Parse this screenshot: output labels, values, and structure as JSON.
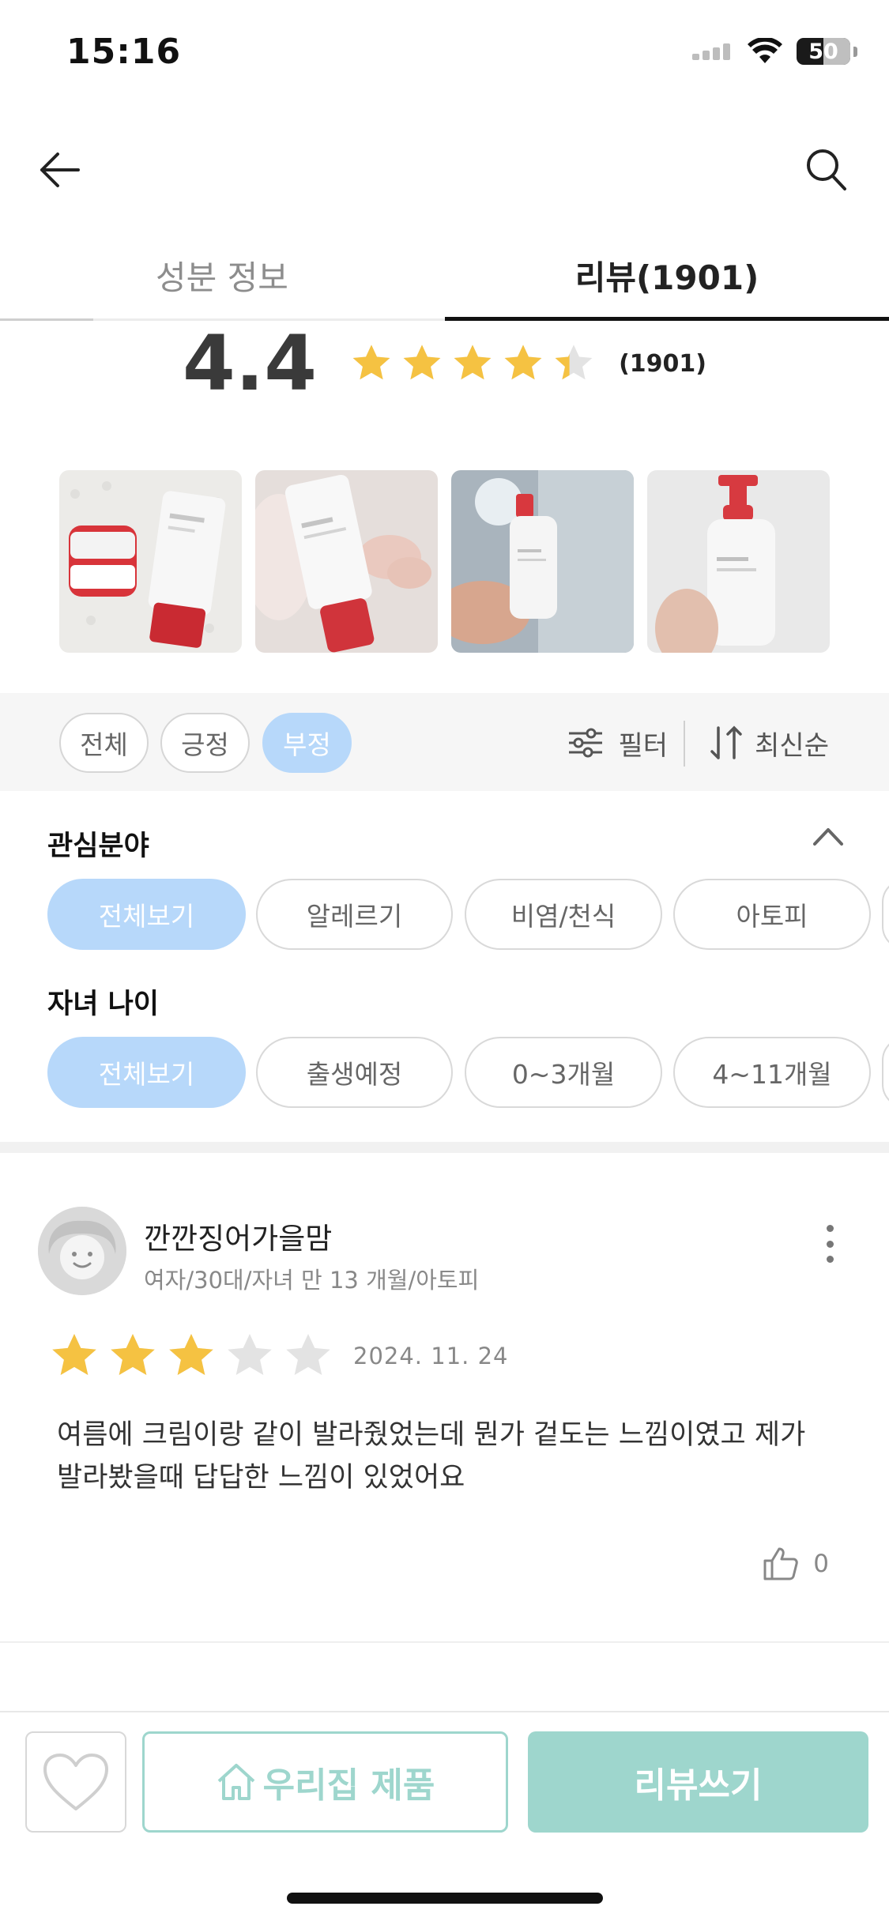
{
  "status_bar": {
    "time": "15:16",
    "battery": "50"
  },
  "tabs": [
    {
      "label": "성분 정보",
      "active": false
    },
    {
      "label": "리뷰(1901)",
      "active": true
    }
  ],
  "rating": {
    "score": "4.4",
    "count": "(1901)",
    "stars": 4.4
  },
  "photos": [
    {
      "icon": "product-photo-cream-jar-and-tube"
    },
    {
      "icon": "product-photo-lotion-tube-with-baby"
    },
    {
      "icon": "product-photo-pump-bottle-in-bath"
    },
    {
      "icon": "product-photo-pump-bottle-in-hand"
    }
  ],
  "filter_chips": [
    {
      "label": "전체",
      "selected": false
    },
    {
      "label": "긍정",
      "selected": false
    },
    {
      "label": "부정",
      "selected": true
    }
  ],
  "filter_label": "필터",
  "sort_label": "최신순",
  "interest": {
    "title": "관심분야",
    "options": [
      "전체보기",
      "알레르기",
      "비염/천식",
      "아토피"
    ],
    "selected": "전체보기"
  },
  "child_age": {
    "title": "자녀 나이",
    "options": [
      "전체보기",
      "출생예정",
      "0~3개월",
      "4~11개월"
    ],
    "selected": "전체보기"
  },
  "review": {
    "name": "깐깐징어가을맘",
    "meta": "여자/30대/자녀 만 13 개월/아토피",
    "stars": 3,
    "date": "2024. 11. 24",
    "text": "여름에 크림이랑 같이 발라줬었는데 뭔가 겉도는 느낌이였고 제가 발라봤을때 답답한 느낌이 있었어요",
    "likes": "0"
  },
  "bottom": {
    "home_label": "우리집 제품",
    "write_label": "리뷰쓰기"
  },
  "colors": {
    "star": "#f5c242",
    "star_empty": "#e3e3e3",
    "chip_selected": "#b7d8fa",
    "mint": "#9ed6cd"
  }
}
